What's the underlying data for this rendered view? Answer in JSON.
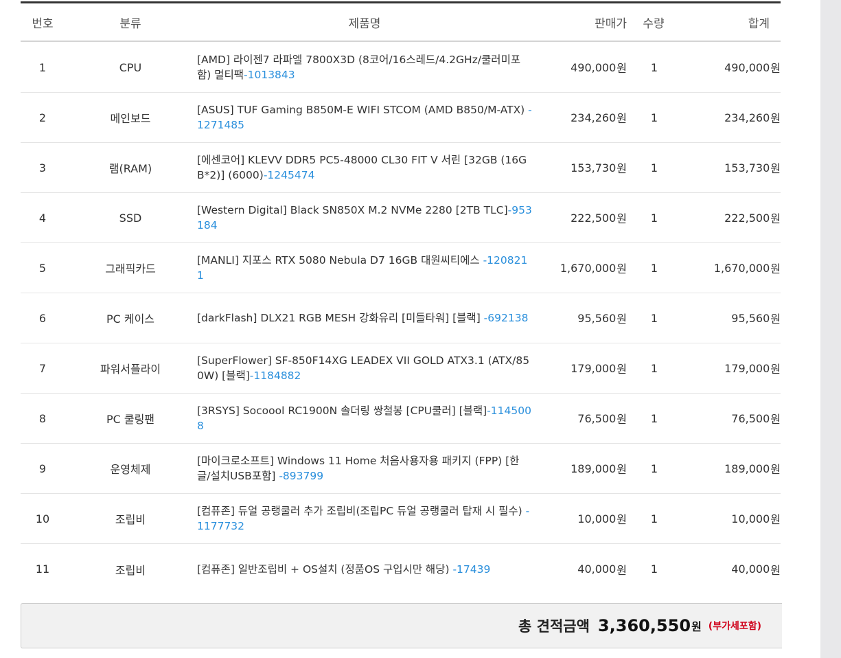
{
  "table": {
    "headers": {
      "no": "번호",
      "category": "분류",
      "product_name": "제품명",
      "price": "판매가",
      "quantity": "수량",
      "total": "합계"
    },
    "rows": [
      {
        "no": "1",
        "category": "CPU",
        "name": "[AMD] 라이젠7 라파엘 7800X3D (8코어/16스레드/4.2GHz/쿨러미포함) 멀티팩",
        "code": "-1013843",
        "price": "490,000",
        "price_unit": "원",
        "qty": "1",
        "total": "490,000",
        "total_unit": "원"
      },
      {
        "no": "2",
        "category": "메인보드",
        "name": "[ASUS] TUF Gaming B850M-E WIFI STCOM (AMD B850/M-ATX) ",
        "code": "-1271485",
        "price": "234,260",
        "price_unit": "원",
        "qty": "1",
        "total": "234,260",
        "total_unit": "원"
      },
      {
        "no": "3",
        "category": "램(RAM)",
        "name": "[에센코어] KLEVV DDR5 PC5-48000 CL30 FIT V 서린 [32GB (16GB*2)] (6000)",
        "code": "-1245474",
        "price": "153,730",
        "price_unit": "원",
        "qty": "1",
        "total": "153,730",
        "total_unit": "원"
      },
      {
        "no": "4",
        "category": "SSD",
        "name": "[Western Digital] Black SN850X M.2 NVMe 2280 [2TB TLC]",
        "code": "-953184",
        "price": "222,500",
        "price_unit": "원",
        "qty": "1",
        "total": "222,500",
        "total_unit": "원"
      },
      {
        "no": "5",
        "category": "그래픽카드",
        "name": "[MANLI] 지포스 RTX 5080 Nebula D7 16GB 대원씨티에스 ",
        "code": "-1208211",
        "price": "1,670,000",
        "price_unit": "원",
        "qty": "1",
        "total": "1,670,000",
        "total_unit": "원"
      },
      {
        "no": "6",
        "category": "PC 케이스",
        "name": "[darkFlash] DLX21 RGB MESH 강화유리 [미들타워] [블랙] ",
        "code": "-692138",
        "price": "95,560",
        "price_unit": "원",
        "qty": "1",
        "total": "95,560",
        "total_unit": "원"
      },
      {
        "no": "7",
        "category": "파워서플라이",
        "name": "[SuperFlower] SF-850F14XG LEADEX VII GOLD ATX3.1 (ATX/850W) [블랙]",
        "code": "-1184882",
        "price": "179,000",
        "price_unit": "원",
        "qty": "1",
        "total": "179,000",
        "total_unit": "원"
      },
      {
        "no": "8",
        "category": "PC 쿨링팬",
        "name": "[3RSYS] Socoool RC1900N 솔더링 쌍철봉 [CPU쿨러] [블랙]",
        "code": "-1145008",
        "price": "76,500",
        "price_unit": "원",
        "qty": "1",
        "total": "76,500",
        "total_unit": "원"
      },
      {
        "no": "9",
        "category": "운영체제",
        "name": "[마이크로소프트] Windows 11 Home 처음사용자용 패키지 (FPP) [한글/설치USB포함] ",
        "code": "-893799",
        "price": "189,000",
        "price_unit": "원",
        "qty": "1",
        "total": "189,000",
        "total_unit": "원"
      },
      {
        "no": "10",
        "category": "조립비",
        "name": "[컴퓨존] 듀얼 공랭쿨러 추가 조립비(조립PC 듀얼 공랭쿨러 탑재 시 필수) ",
        "code": "-1177732",
        "price": "10,000",
        "price_unit": "원",
        "qty": "1",
        "total": "10,000",
        "total_unit": "원"
      },
      {
        "no": "11",
        "category": "조립비",
        "name": "[컴퓨존] 일반조립비 + OS설치 (정품OS 구입시만 해당) ",
        "code": "-17439",
        "price": "40,000",
        "price_unit": "원",
        "qty": "1",
        "total": "40,000",
        "total_unit": "원"
      }
    ]
  },
  "summary": {
    "label": "총 견적금액",
    "amount": "3,360,550",
    "unit": "원",
    "vat_note": "(부가세포함)"
  },
  "colors": {
    "code_link": "#2a8fdc",
    "vat_note": "#d0021b",
    "header_border": "#333333",
    "total_bg": "#f1f1f1"
  }
}
